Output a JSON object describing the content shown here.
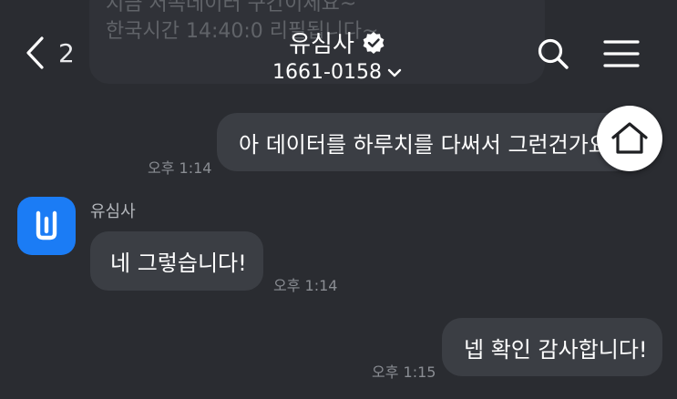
{
  "background_color": "#2a2c31",
  "header": {
    "back_count": "2",
    "title": "유심사",
    "phone": "1661-0158",
    "icons": [
      "chevron-left-icon",
      "verified-badge-icon",
      "chevron-down-icon",
      "search-icon",
      "menu-icon"
    ]
  },
  "faded_message": {
    "lines": [
      "",
      "지금 저속데이터 구간이세요~",
      "한국시간 14:40:0 리필됩니다~"
    ]
  },
  "messages": [
    {
      "type": "outgoing",
      "text": "아 데이터를 하루치를 다써서 그런건가요",
      "time": "오후 1:14"
    },
    {
      "type": "incoming",
      "sender": "유심사",
      "text": "네 그렇습니다!",
      "time": "오후 1:14"
    },
    {
      "type": "outgoing",
      "text": "넵 확인 감사합니다!",
      "time": "오후 1:15"
    }
  ],
  "avatar": {
    "brand_color": "#1b7cf5",
    "icon": "usimsa-logo-icon"
  },
  "floating_button": {
    "icon": "home-icon"
  }
}
